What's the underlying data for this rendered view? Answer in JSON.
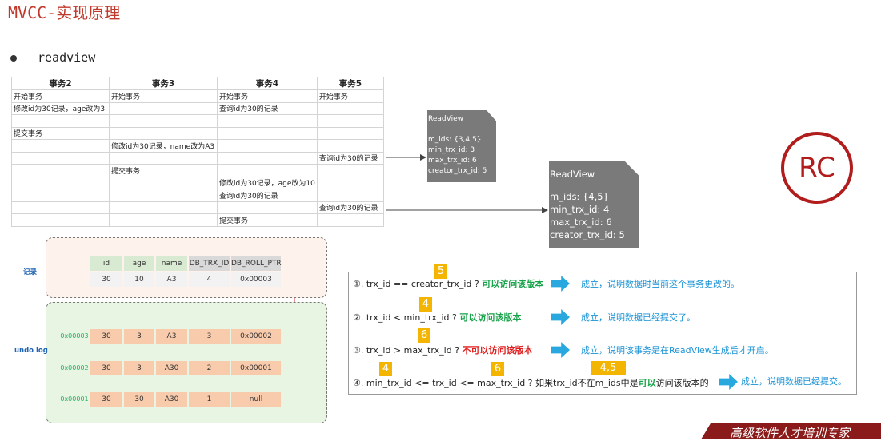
{
  "title": "MVCC-实现原理",
  "bullet": "readview",
  "tx_table": {
    "headers": [
      "事务2",
      "事务3",
      "事务4",
      "事务5"
    ],
    "rows": [
      [
        "开始事务",
        "开始事务",
        "开始事务",
        "开始事务"
      ],
      [
        "修改id为30记录，age改为3",
        "",
        "查询id为30的记录",
        ""
      ],
      [
        "",
        "",
        "",
        ""
      ],
      [
        "提交事务",
        "",
        "",
        ""
      ],
      [
        "",
        "修改id为30记录，name改为A3",
        "",
        ""
      ],
      [
        "",
        "",
        "",
        "查询id为30的记录"
      ],
      [
        "",
        "提交事务",
        "",
        ""
      ],
      [
        "",
        "",
        "修改id为30记录，age改为10",
        ""
      ],
      [
        "",
        "",
        "查询id为30的记录",
        ""
      ],
      [
        "",
        "",
        "",
        "查询id为30的记录"
      ],
      [
        "",
        "",
        "提交事务",
        ""
      ]
    ]
  },
  "readview1": {
    "title": "ReadView",
    "m_ids": "m_ids: {3,4,5}",
    "min_trx_id": "min_trx_id: 3",
    "max_trx_id": "max_trx_id: 6",
    "creator_trx_id": "creator_trx_id: 5"
  },
  "readview2": {
    "title": "ReadView",
    "m_ids": "m_ids: {4,5}",
    "min_trx_id": "min_trx_id: 4",
    "max_trx_id": "max_trx_id: 6",
    "creator_trx_id": "creator_trx_id: 5"
  },
  "rc_label": "RC",
  "record": {
    "label": "记录",
    "headers": [
      "id",
      "age",
      "name",
      "DB_TRX_ID",
      "DB_ROLL_PTR"
    ],
    "values": [
      "30",
      "10",
      "A3",
      "4",
      "0x00003"
    ]
  },
  "undo_log": {
    "label": "undo log",
    "rows": [
      {
        "addr": "0x00003",
        "values": [
          "30",
          "3",
          "A3",
          "3",
          "0x00002"
        ]
      },
      {
        "addr": "0x00002",
        "values": [
          "30",
          "3",
          "A30",
          "2",
          "0x00001"
        ]
      },
      {
        "addr": "0x00001",
        "values": [
          "30",
          "30",
          "A30",
          "1",
          "null"
        ]
      }
    ]
  },
  "rules": [
    {
      "text": "①. trx_id  == creator_trx_id ?",
      "hint": "可以访问该版本",
      "hint_color": "green",
      "conclusion": "成立，说明数据时当前这个事务更改的。",
      "badge": "5"
    },
    {
      "text": "②. trx_id < min_trx_id ?",
      "hint": "可以访问该版本",
      "hint_color": "green",
      "conclusion": "成立，说明数据已经提交了。",
      "badge": "4"
    },
    {
      "text": "③. trx_id > max_trx_id ?",
      "hint": "不可以访问该版本",
      "hint_color": "red",
      "conclusion": "成立，说明该事务是在ReadView生成后才开启。",
      "badge": "6"
    }
  ],
  "rule4": {
    "text": "④. min_trx_id <= trx_id <= max_trx_id ?  如果trx_id",
    "not_in": "不在",
    "mid": "m_ids中是",
    "can": "可以",
    "tail": "访问该版本的",
    "conclusion": "成立，说明数据已经提交。",
    "badge_a": "4",
    "badge_b": "6",
    "badge_c": "4,5"
  },
  "footer": "高级软件人才培训专家",
  "colors": {
    "title": "#c0392b",
    "rc": "#b11d1d",
    "arrow": "#29a8e0",
    "badge": "#f3b500"
  }
}
